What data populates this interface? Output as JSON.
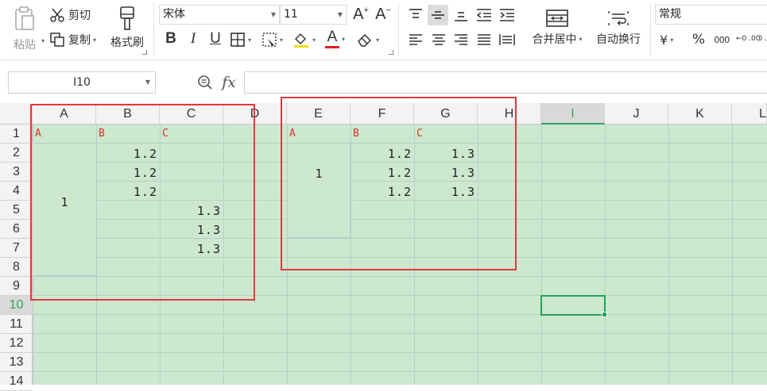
{
  "ribbon": {
    "paste_label": "粘贴",
    "cut_label": "剪切",
    "copy_label": "复制",
    "format_painter_label": "格式刷",
    "font_name": "宋体",
    "font_size": "11",
    "merge_center_label": "合并居中",
    "wrap_text_label": "自动换行",
    "number_format": "常规",
    "percent_symbol": "%",
    "thousands_symbol": "000",
    "currency_symbol": "¥",
    "bold_label": "B",
    "italic_label": "I",
    "underline_label": "U",
    "font_color_label": "A",
    "increase_font_label": "A",
    "decrease_font_label": "A",
    "decimal_inc_label": "←0 .00",
    "decimal_dec_label": "0 .0"
  },
  "formula_bar": {
    "name_box": "I10",
    "fx_label": "fx",
    "formula_value": ""
  },
  "columns": [
    "A",
    "B",
    "C",
    "D",
    "E",
    "F",
    "G",
    "H",
    "I",
    "J",
    "K",
    "L"
  ],
  "selected_column": "I",
  "rows": [
    "1",
    "2",
    "3",
    "4",
    "5",
    "6",
    "7",
    "8",
    "9",
    "10",
    "11",
    "12",
    "13",
    "14"
  ],
  "selected_row": "10",
  "cells": {
    "A1": "A",
    "B1": "B",
    "C1": "C",
    "A2_merged": "1",
    "B2": "1.2",
    "B3": "1.2",
    "B4": "1.2",
    "C5": "1.3",
    "C6": "1.3",
    "C7": "1.3",
    "E1": "A",
    "F1": "B",
    "G1": "C",
    "E2_merged": "1",
    "F2": "1.2",
    "F3": "1.2",
    "F4": "1.2",
    "G2": "1.3",
    "G3": "1.3",
    "G4": "1.3"
  },
  "colors": {
    "cell_bg": "#cce8cf",
    "highlight_box": "#e0393e",
    "selection": "#23a35a",
    "header_text_red": "#d9342b"
  }
}
